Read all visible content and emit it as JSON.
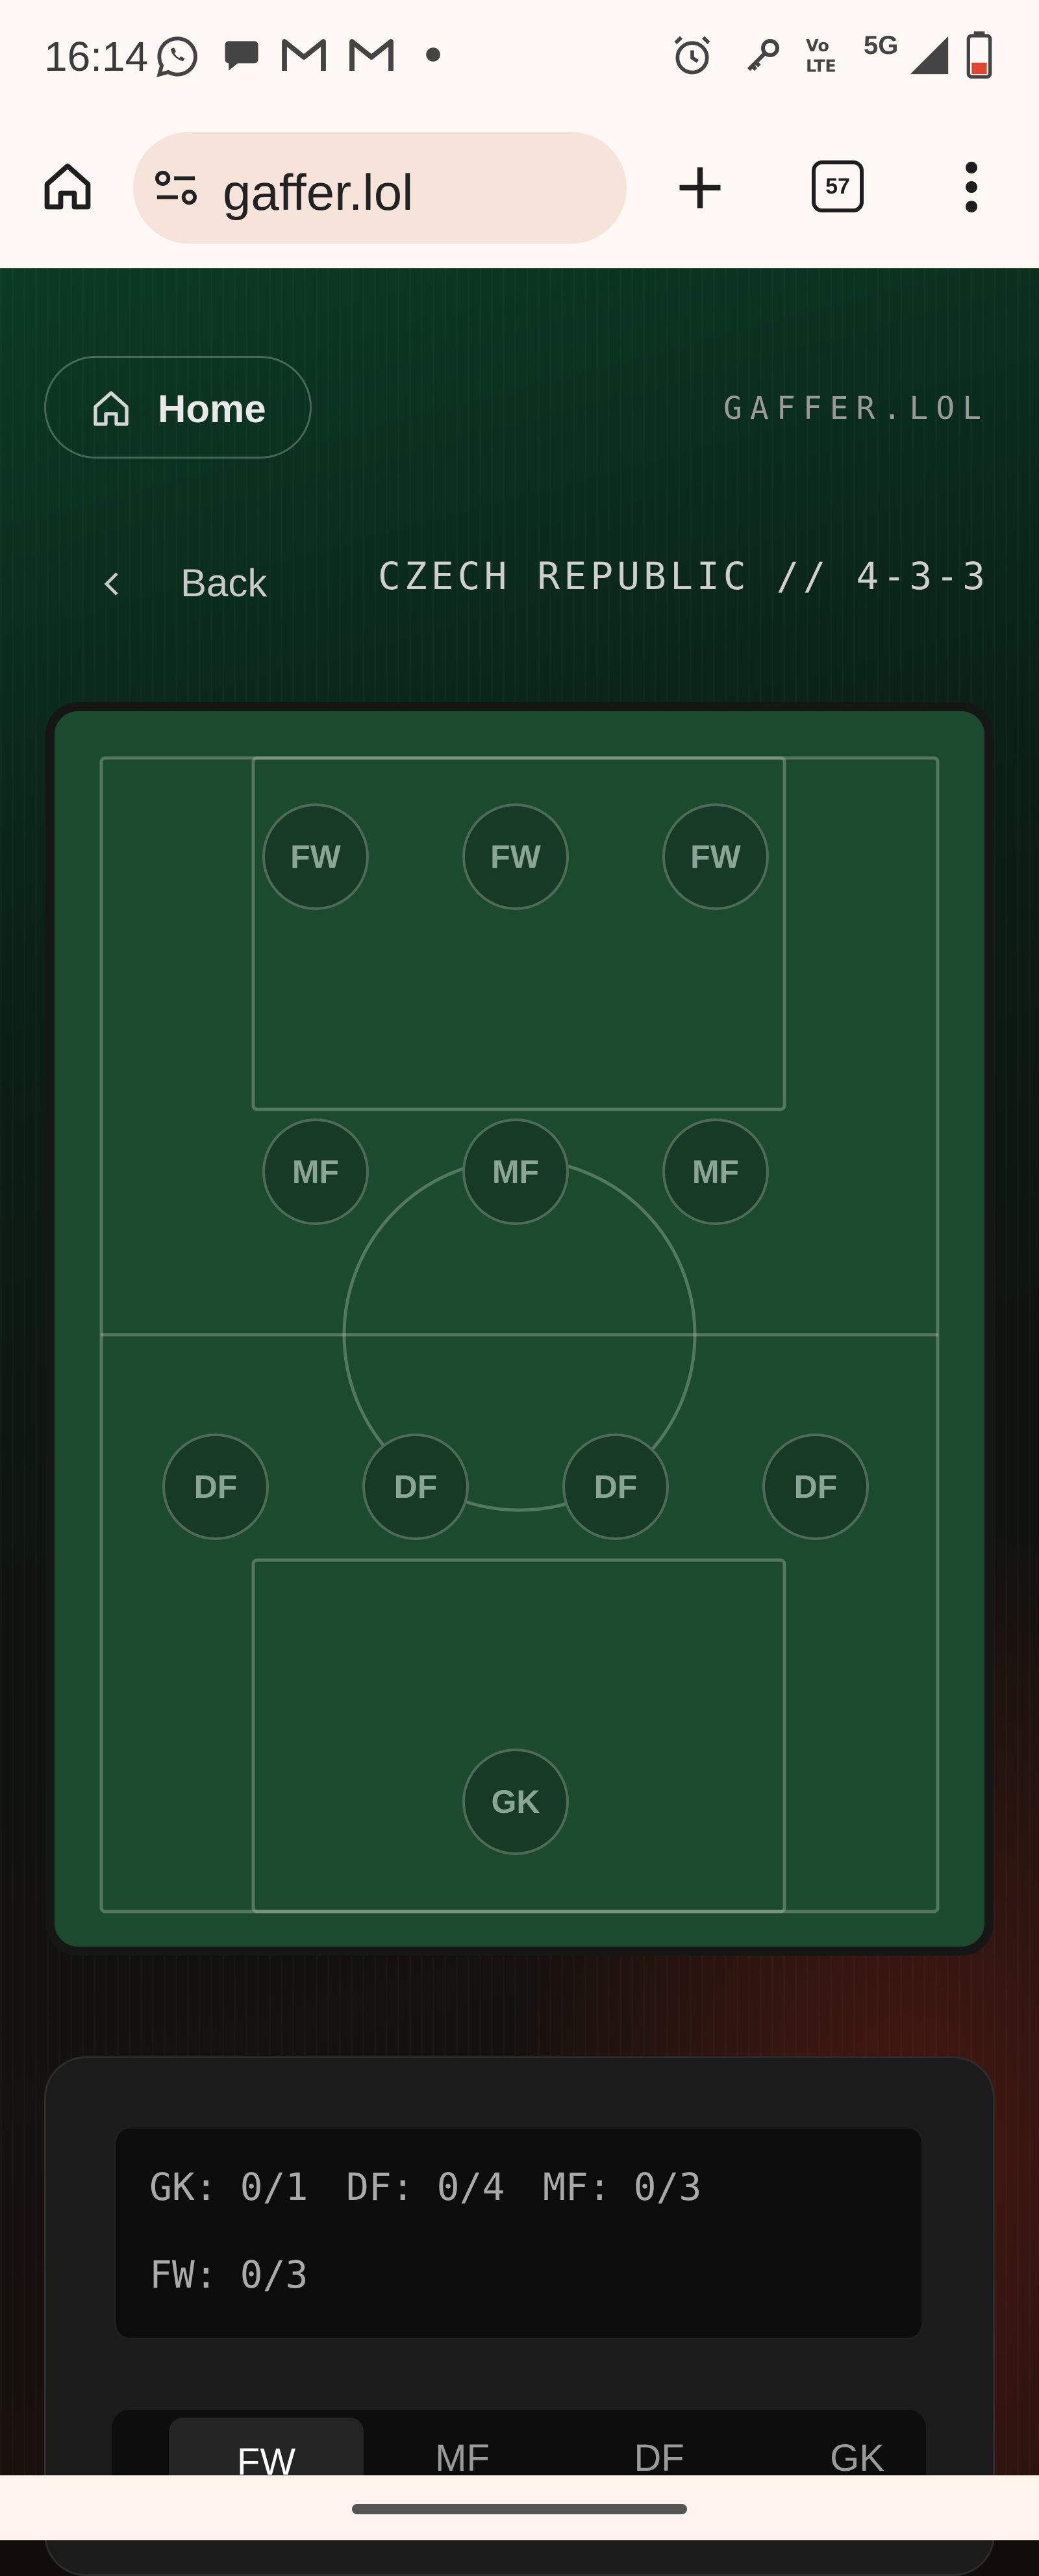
{
  "status_bar": {
    "time": "16:14",
    "network": "5G",
    "volte": "Vo LTE",
    "notification_icons": [
      "whatsapp-icon",
      "chat-icon",
      "gmail-icon",
      "gmail-icon",
      "dot-icon"
    ],
    "system_icons": [
      "alarm-icon",
      "key-icon",
      "volte-icon",
      "signal-icon",
      "battery-icon"
    ]
  },
  "browser": {
    "url": "gaffer.lol",
    "tab_count": "57"
  },
  "header": {
    "home_label": "Home",
    "brand": "GAFFER.LOL",
    "back_label": "Back",
    "team_formation": "CZECH REPUBLIC // 4-3-3"
  },
  "pitch": {
    "slots": [
      {
        "label": "FW"
      },
      {
        "label": "FW"
      },
      {
        "label": "FW"
      },
      {
        "label": "MF"
      },
      {
        "label": "MF"
      },
      {
        "label": "MF"
      },
      {
        "label": "DF"
      },
      {
        "label": "DF"
      },
      {
        "label": "DF"
      },
      {
        "label": "DF"
      },
      {
        "label": "GK"
      }
    ]
  },
  "summary": {
    "gk": "GK: 0/1",
    "df": "DF: 0/4",
    "mf": "MF: 0/3",
    "fw": "FW: 0/3"
  },
  "tabs": [
    {
      "label": "FW",
      "active": true
    },
    {
      "label": "MF",
      "active": false
    },
    {
      "label": "DF",
      "active": false
    },
    {
      "label": "GK",
      "active": false
    }
  ],
  "colors": {
    "pitch": "#1c4a2f",
    "slot": "#163a25",
    "accent": "#ffffff"
  }
}
